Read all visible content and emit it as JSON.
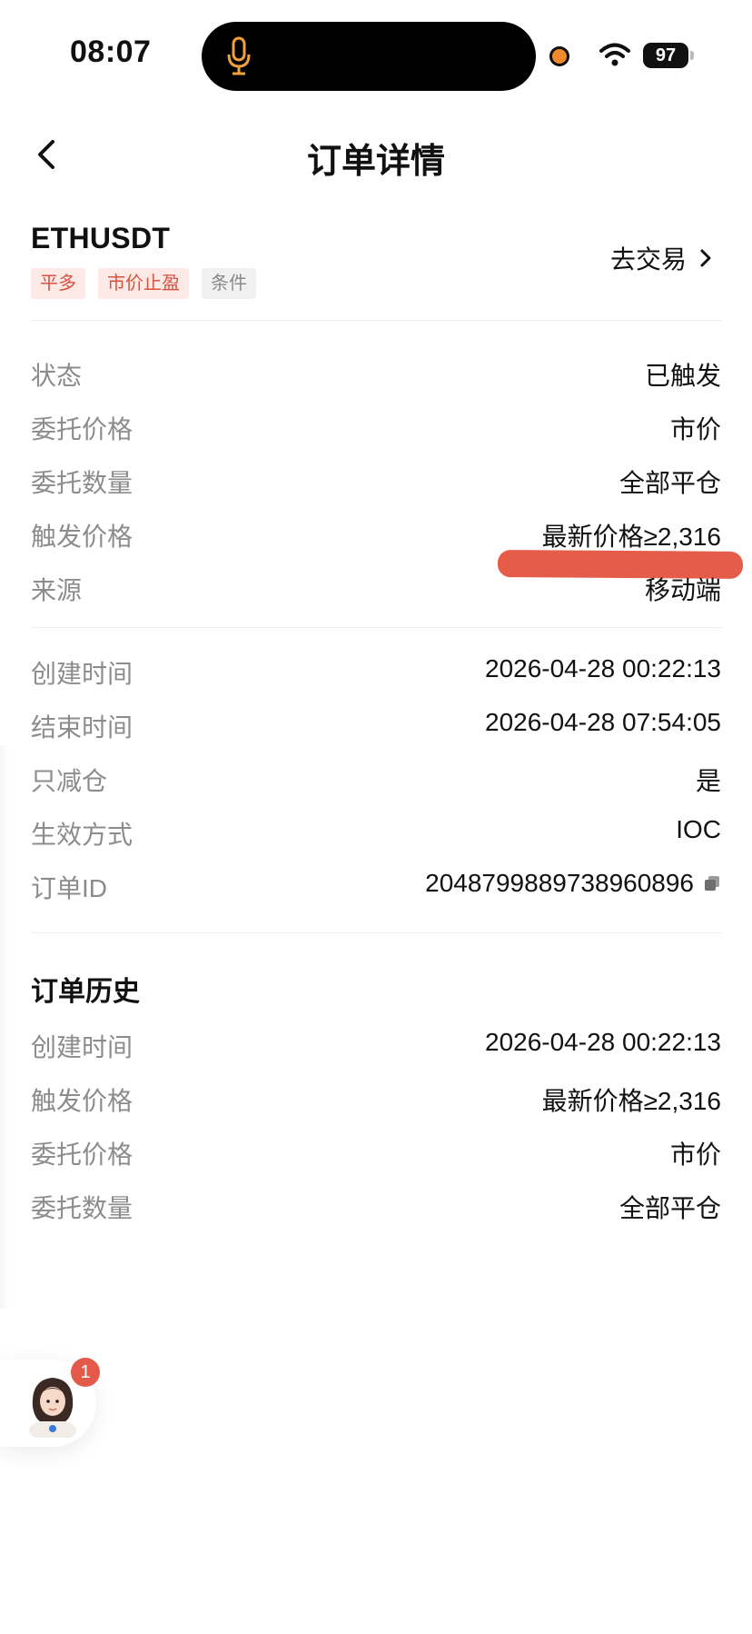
{
  "status_bar": {
    "time": "08:07",
    "battery": "97"
  },
  "nav": {
    "title": "订单详情"
  },
  "order": {
    "symbol": "ETHUSDT",
    "tags": [
      "平多",
      "市价止盈",
      "条件"
    ],
    "trade_link": "去交易"
  },
  "details": [
    {
      "label": "状态",
      "value": "已触发"
    },
    {
      "label": "委托价格",
      "value": "市价"
    },
    {
      "label": "委托数量",
      "value": "全部平仓"
    },
    {
      "label": "触发价格",
      "value": "最新价格≥2,316"
    },
    {
      "label": "来源",
      "value": "移动端"
    }
  ],
  "info": [
    {
      "label": "创建时间",
      "value": "2026-04-28 00:22:13"
    },
    {
      "label": "结束时间",
      "value": "2026-04-28 07:54:05"
    },
    {
      "label": "只减仓",
      "value": "是"
    },
    {
      "label": "生效方式",
      "value": "IOC"
    },
    {
      "label": "订单ID",
      "value": "2048799889738960896"
    }
  ],
  "history": {
    "title": "订单历史",
    "rows": [
      {
        "label": "创建时间",
        "value": "2026-04-28 00:22:13"
      },
      {
        "label": "触发价格",
        "value": "最新价格≥2,316"
      },
      {
        "label": "委托价格",
        "value": "市价"
      },
      {
        "label": "委托数量",
        "value": "全部平仓"
      }
    ]
  },
  "assistant": {
    "badge": "1"
  },
  "colors": {
    "accent_red": "#e35a4b",
    "tag_red_bg": "#fde9e6",
    "label_gray": "#8c8c8c"
  }
}
